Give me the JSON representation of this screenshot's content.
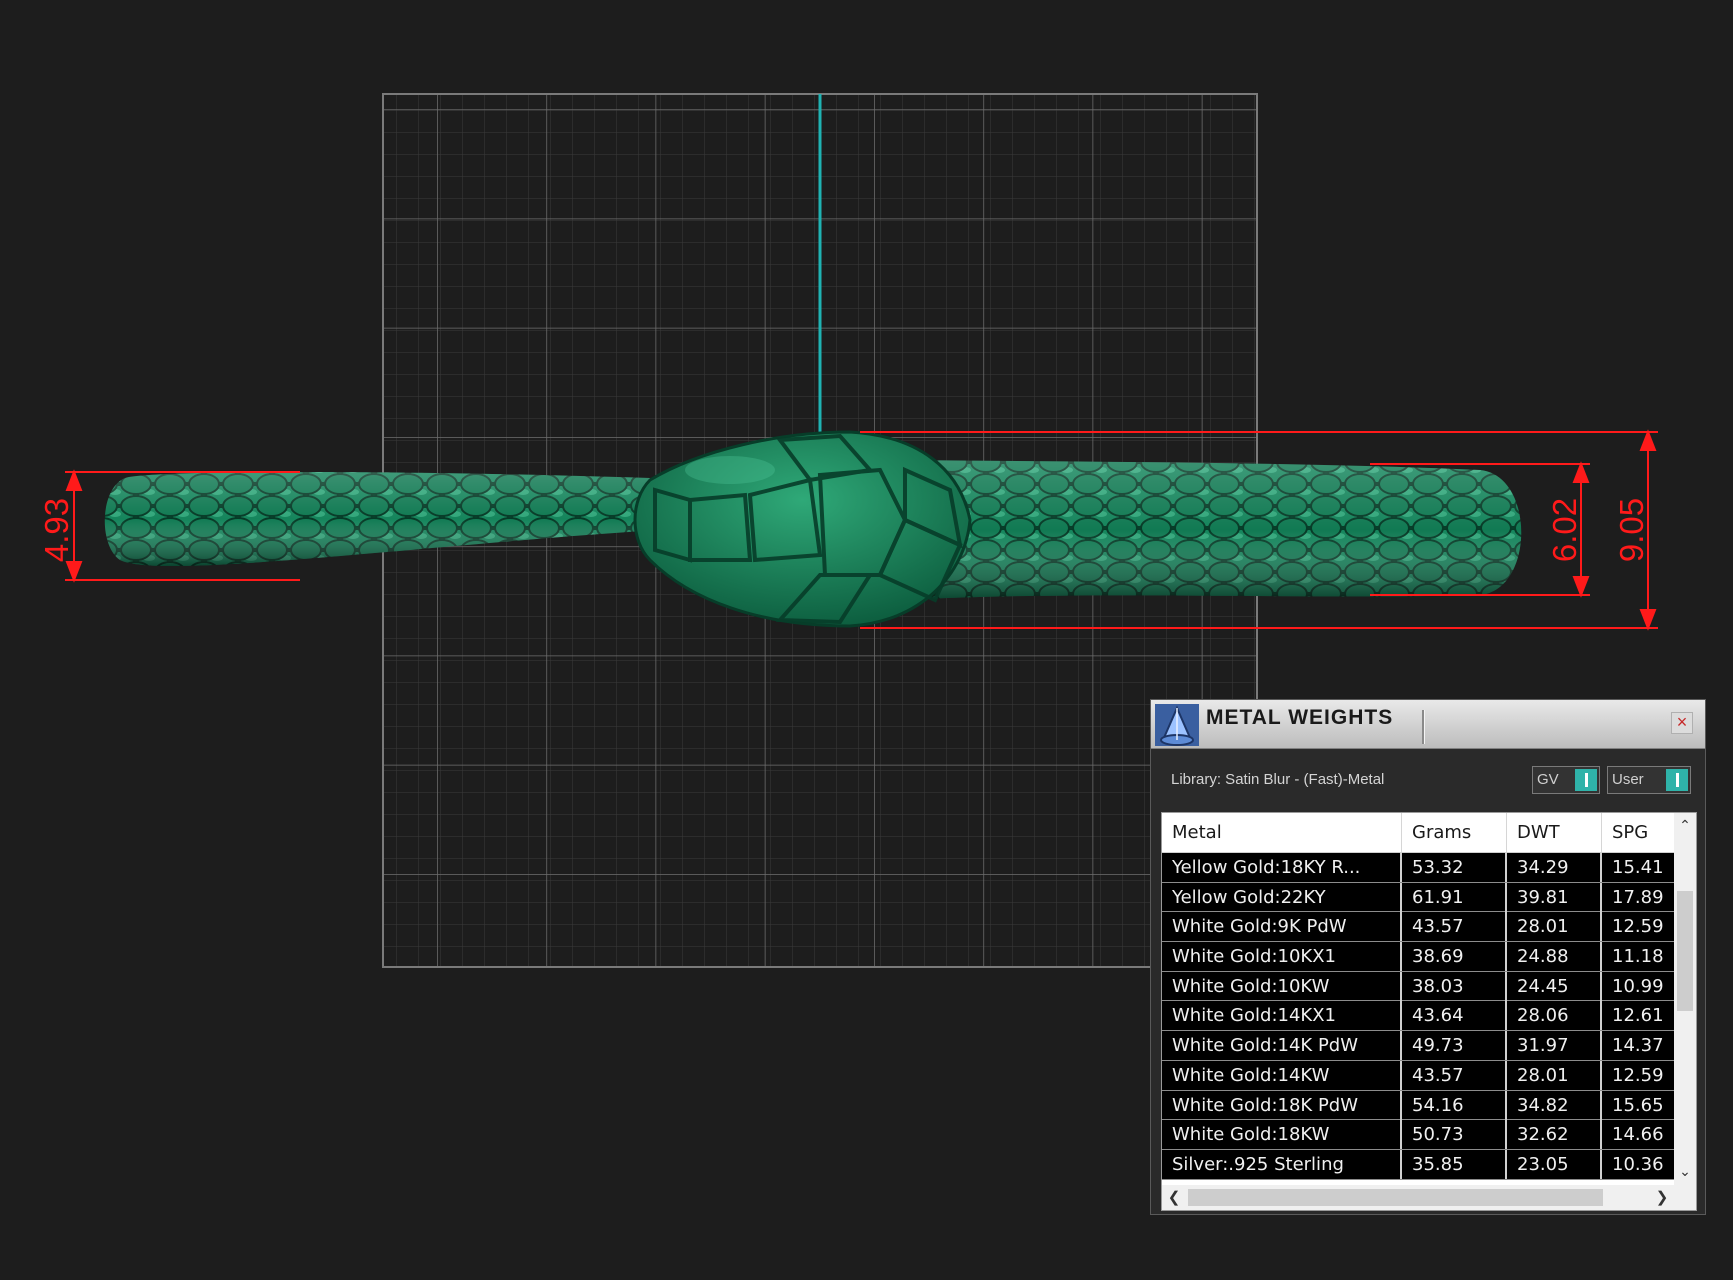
{
  "viewport": {
    "measurements": {
      "left_height": "4.93",
      "right_inner_height": "6.02",
      "right_outer_height": "9.05"
    },
    "model_color": "#0f6b49",
    "dimension_color": "#ff1a1a",
    "axis_color": "#1fb3b3"
  },
  "panel": {
    "title": "METAL WEIGHTS",
    "icon": "pendant-gem-icon",
    "close_label": "×",
    "library_label": "Library: Satin Blur - (Fast)-Metal",
    "toggle_gv": "GV",
    "toggle_user": "User",
    "columns": [
      "Metal",
      "Grams",
      "DWT",
      "SPG"
    ],
    "rows": [
      {
        "metal": "Yellow Gold:18KY R...",
        "grams": "53.32",
        "dwt": "34.29",
        "spg": "15.41"
      },
      {
        "metal": "Yellow Gold:22KY",
        "grams": "61.91",
        "dwt": "39.81",
        "spg": "17.89"
      },
      {
        "metal": "White Gold:9K PdW",
        "grams": "43.57",
        "dwt": "28.01",
        "spg": "12.59"
      },
      {
        "metal": "White Gold:10KX1",
        "grams": "38.69",
        "dwt": "24.88",
        "spg": "11.18"
      },
      {
        "metal": "White Gold:10KW",
        "grams": "38.03",
        "dwt": "24.45",
        "spg": "10.99"
      },
      {
        "metal": "White Gold:14KX1",
        "grams": "43.64",
        "dwt": "28.06",
        "spg": "12.61"
      },
      {
        "metal": "White Gold:14K PdW",
        "grams": "49.73",
        "dwt": "31.97",
        "spg": "14.37"
      },
      {
        "metal": "White Gold:14KW",
        "grams": "43.57",
        "dwt": "28.01",
        "spg": "12.59"
      },
      {
        "metal": "White Gold:18K PdW",
        "grams": "54.16",
        "dwt": "34.82",
        "spg": "15.65"
      },
      {
        "metal": "White Gold:18KW",
        "grams": "50.73",
        "dwt": "32.62",
        "spg": "14.66"
      },
      {
        "metal": "Silver:.925 Sterling",
        "grams": "35.85",
        "dwt": "23.05",
        "spg": "10.36"
      }
    ]
  }
}
